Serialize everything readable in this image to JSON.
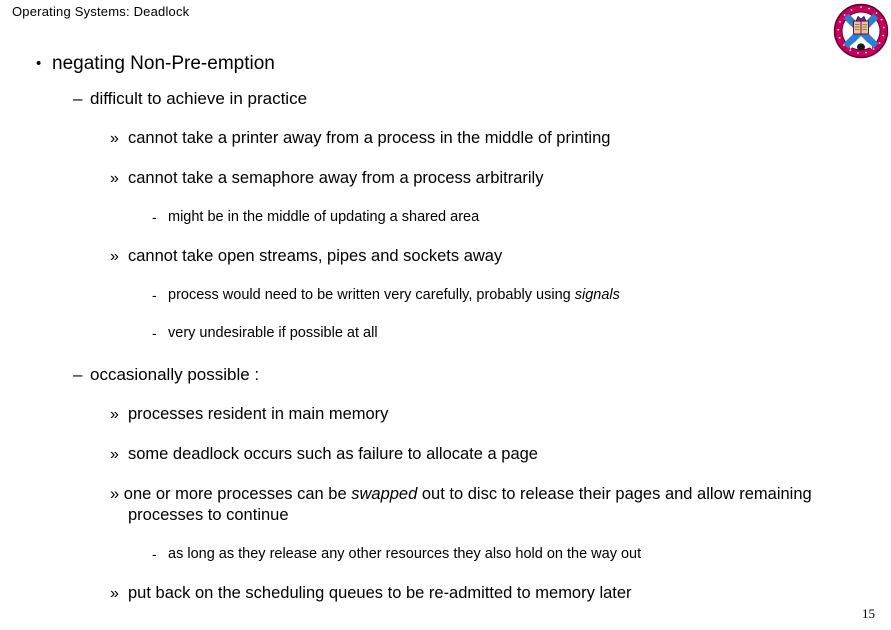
{
  "slide": {
    "header": "Operating Systems: Deadlock",
    "page_number": "15",
    "logo": {
      "name": "university-of-edinburgh-crest",
      "ring_text_top": "UNIVERSITY",
      "ring_text_bottom": "OF EDINBURGH",
      "colors": {
        "ring": "#c8005a",
        "saltire": "#2f7fd0",
        "field": "#ffffff",
        "book": "#e8c49a",
        "outline": "#5a0030"
      }
    },
    "markers": {
      "level1": "•",
      "level2": "–",
      "level3": "»",
      "level4": "-"
    },
    "content": [
      {
        "level": 1,
        "marker": "•",
        "text": "negating Non-Pre-emption"
      },
      {
        "level": 2,
        "marker": "–",
        "text": "difficult to achieve in practice"
      },
      {
        "level": 3,
        "marker": "»",
        "text": "cannot take a printer away from a process in the middle of printing"
      },
      {
        "level": 3,
        "marker": "»",
        "text": "cannot take a semaphore away from a process arbitrarily"
      },
      {
        "level": 4,
        "marker": "-",
        "text": "might be in the middle of updating a shared area"
      },
      {
        "level": 3,
        "marker": "»",
        "text": "cannot take open streams, pipes and sockets away"
      },
      {
        "level": 4,
        "marker": "-",
        "text_before": "process would need to be written very carefully, probably using ",
        "text_italic": "signals",
        "text_after": ""
      },
      {
        "level": 4,
        "marker": "-",
        "text": "very undesirable if possible at all"
      },
      {
        "level": 2,
        "marker": "–",
        "text": "occasionally possible :"
      },
      {
        "level": 3,
        "marker": "»",
        "text": "processes resident in main memory"
      },
      {
        "level": 3,
        "marker": "»",
        "text": "some deadlock occurs such as failure to allocate a page"
      },
      {
        "level": 3,
        "marker": "»",
        "text_before": "one or more processes can be ",
        "text_italic": "swapped",
        "text_after": " out to disc to release their pages and allow remaining processes to continue"
      },
      {
        "level": 4,
        "marker": "-",
        "text": "as long as they release any other resources they also hold on the way out"
      },
      {
        "level": 3,
        "marker": "»",
        "text": "put back on the scheduling queues to be re-admitted to memory later"
      }
    ]
  }
}
